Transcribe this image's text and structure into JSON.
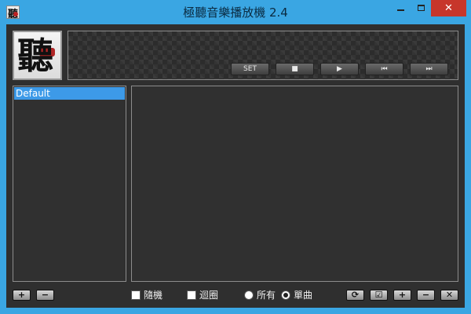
{
  "window": {
    "title": "極聽音樂播放機 2.4",
    "icon": "app-logo-icon",
    "controls": {
      "minimize": "minimize-icon",
      "maximize": "maximize-icon",
      "close": "✕"
    }
  },
  "logo": {
    "character": "聽"
  },
  "player_controls": {
    "set_label": "SET",
    "stop_label": "■",
    "play_label": "▶",
    "prev_label": "⏮",
    "next_label": "⏭"
  },
  "playlists": {
    "items": [
      {
        "label": "Default",
        "selected": true
      }
    ]
  },
  "bottom_bar": {
    "add_playlist": "+",
    "remove_playlist": "−",
    "random_label": "隨機",
    "loop_label": "迴圈",
    "all_label": "所有",
    "single_label": "單曲",
    "refresh": "⟳",
    "check": "☑",
    "add_track": "+",
    "remove_track": "−",
    "clear_track": "✕"
  },
  "colors": {
    "titlebar": "#3aa6e3",
    "selection": "#3d9ae8",
    "close_button": "#c7362b",
    "client_bg": "#2f2f2f"
  }
}
